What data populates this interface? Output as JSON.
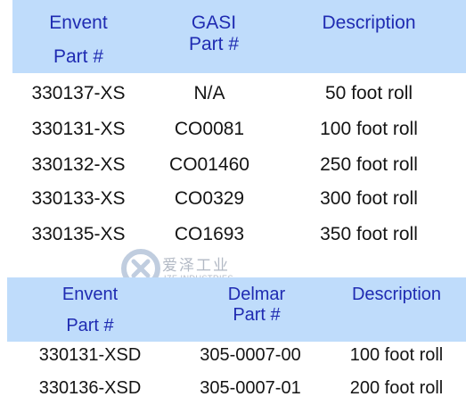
{
  "colors": {
    "header_bg": "#bfdcfb",
    "header_text": "#1f2bb2"
  },
  "table1": {
    "headers": {
      "col1": [
        "Envent",
        "Part #"
      ],
      "col2": [
        "GASI",
        "Part #"
      ],
      "col3": [
        "Description"
      ]
    },
    "rows": [
      [
        "330137-XS",
        "N/A",
        "50 foot roll"
      ],
      [
        "330131-XS",
        "CO0081",
        "100 foot roll"
      ],
      [
        "330132-XS",
        "CO01460",
        "250 foot roll"
      ],
      [
        "330133-XS",
        "CO0329",
        "300 foot roll"
      ],
      [
        "330135-XS",
        "CO1693",
        "350 foot roll"
      ]
    ]
  },
  "table2": {
    "headers": {
      "col1": [
        "Envent",
        "Part #"
      ],
      "col2": [
        "Delmar",
        "Part #"
      ],
      "col3": [
        "Description"
      ]
    },
    "rows": [
      [
        "330131-XSD",
        "305-0007-00",
        "100 foot roll"
      ],
      [
        "330136-XSD",
        "305-0007-01",
        "200 foot roll"
      ]
    ]
  },
  "watermark": {
    "chinese": "爱泽工业",
    "english": "IZE INDUSTRIES",
    "icon": "ize-logo-icon"
  }
}
